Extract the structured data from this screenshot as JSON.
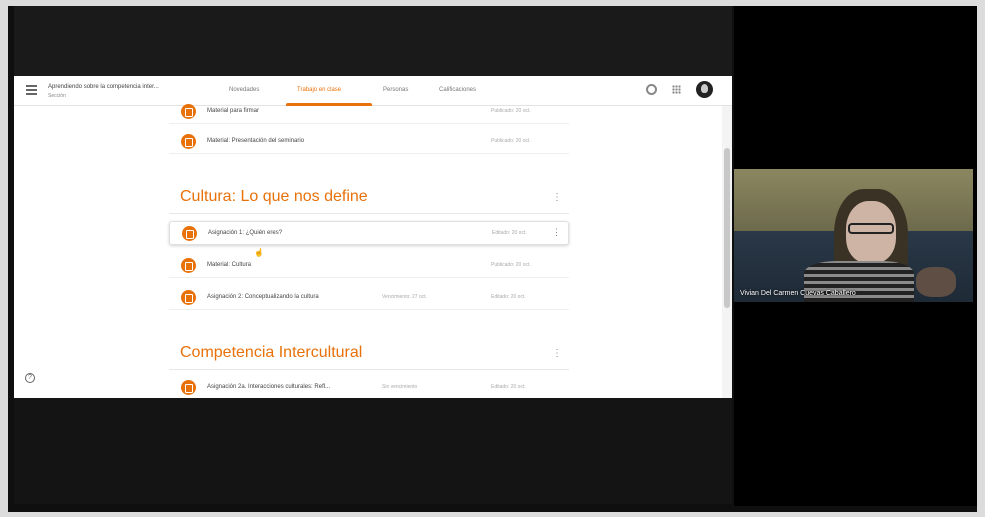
{
  "classroom": {
    "title": "Aprendiendo sobre la competencia inter...",
    "subtitle": "Sección",
    "tabs": [
      {
        "label": "Novedades",
        "active": false
      },
      {
        "label": "Trabajo en clase",
        "active": true
      },
      {
        "label": "Personas",
        "active": false
      },
      {
        "label": "Calificaciones",
        "active": false
      }
    ],
    "accent_color": "#e8710a",
    "icons": [
      "menu-icon",
      "gear-icon",
      "apps-icon",
      "avatar",
      "help-icon",
      "assignment-icon",
      "material-icon",
      "more-vert-icon"
    ]
  },
  "items": [
    {
      "title": "Material para firmar",
      "extra": "",
      "date": "Publicado: 20 oct."
    },
    {
      "title": "Material: Presentación del seminario",
      "extra": "",
      "date": "Publicado: 20 oct."
    },
    {
      "title": "Asignación 1: ¿Quién eres?",
      "extra": "",
      "date": "Editado: 20 oct."
    },
    {
      "title": "Material: Cultura",
      "extra": "",
      "date": "Publicado: 20 oct."
    },
    {
      "title": "Asignación 2: Conceptualizando la cultura",
      "extra": "Vencimiento: 27 oct.",
      "date": "Editado: 20 oct."
    },
    {
      "title": "Asignación 2a. Interacciones culturales: Refl...",
      "extra": "Sin vencimiento",
      "date": "Editado: 20 oct."
    }
  ],
  "sections": [
    {
      "title": "Cultura: Lo que nos define"
    },
    {
      "title": "Competencia Intercultural"
    }
  ],
  "video": {
    "participant_name": "Vivian Del Carmen Cuevas Caballero"
  }
}
